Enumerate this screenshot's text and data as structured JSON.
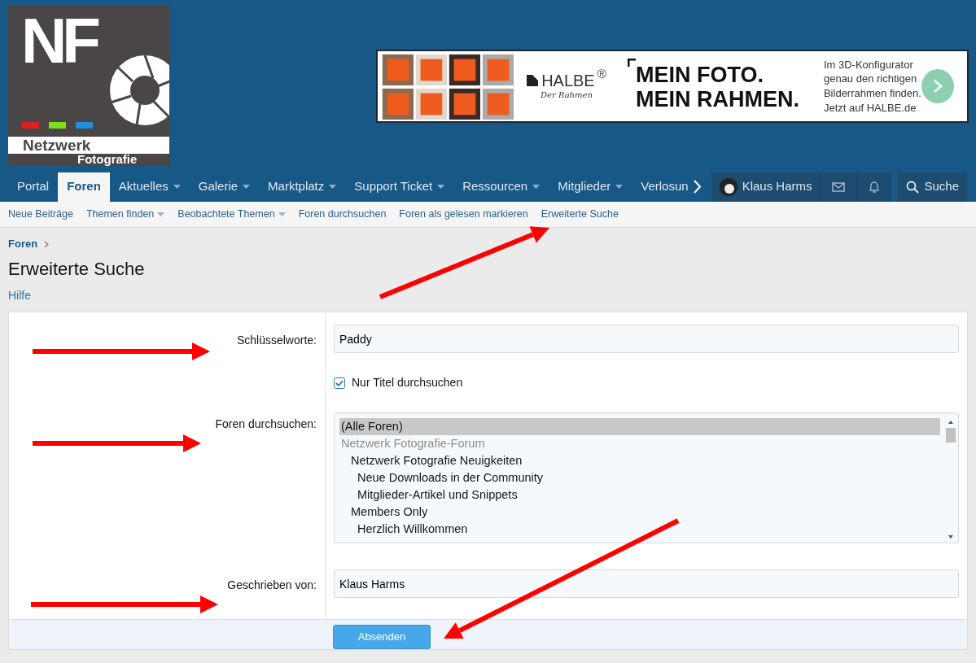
{
  "logo": {
    "initials": "NF",
    "line_1": "Netzwerk",
    "line_2": "Fotografie",
    "color_bars": [
      {
        "color": "#e02020"
      },
      {
        "color": "#7be01a"
      },
      {
        "color": "#1e8fd8"
      }
    ]
  },
  "ad_banner": {
    "brand": "HALBE$^{®}$",
    "brand_tagline": "Der Rahmen",
    "headline": [
      "MEIN FOTO.",
      "MEIN RAHMEN."
    ],
    "text": [
      "Im 3D-Konfigurator",
      "genau den richtigen",
      "Bilderrahmen finden.",
      "Jetzt auf HALBE.de"
    ]
  },
  "nav": {
    "tabs": [
      {
        "label": "Portal",
        "selected": false,
        "has_menu": false
      },
      {
        "label": "Foren",
        "selected": true,
        "has_menu": false
      },
      {
        "label": "Aktuelles",
        "selected": false,
        "has_menu": true
      },
      {
        "label": "Galerie",
        "selected": false,
        "has_menu": true
      },
      {
        "label": "Marktplatz",
        "selected": false,
        "has_menu": true
      },
      {
        "label": "Support Ticket",
        "selected": false,
        "has_menu": true
      },
      {
        "label": "Ressourcen",
        "selected": false,
        "has_menu": true
      },
      {
        "label": "Mitglieder",
        "selected": false,
        "has_menu": true
      },
      {
        "label": "Verlosun",
        "selected": false,
        "has_menu": false
      }
    ],
    "user": {
      "name": "Klaus Harms"
    },
    "search_button": {
      "label": "Suche"
    }
  },
  "subnav": [
    {
      "label": "Neue Beiträge",
      "has_menu": false
    },
    {
      "label": "Themen finden",
      "has_menu": true
    },
    {
      "label": "Beobachtete Themen",
      "has_menu": true
    },
    {
      "label": "Foren durchsuchen",
      "has_menu": false
    },
    {
      "label": "Foren als gelesen markieren",
      "has_menu": false
    },
    {
      "label": "Erweiterte Suche",
      "has_menu": false
    }
  ],
  "breadcrumb": [
    {
      "label": "Foren"
    }
  ],
  "title": "Erweiterte Suche",
  "help_link": "Hilfe",
  "form": {
    "keywords": {
      "label": "Schlüsselworte:",
      "value": "Paddy"
    },
    "title_only": {
      "label": "Nur Titel durchsuchen",
      "checked": true
    },
    "forums": {
      "label": "Foren durchsuchen:",
      "options": [
        {
          "label": "(Alle Foren)",
          "selected": true,
          "disabled": false
        },
        {
          "label": "Netzwerk Fotografie-Forum",
          "selected": false,
          "disabled": true,
          "children": [
            {
              "label": "Netzwerk Fotografie Neuigkeiten",
              "selected": false,
              "disabled": false,
              "children": [
                {
                  "label": "Neue Downloads in der Community",
                  "selected": false,
                  "disabled": false
                },
                {
                  "label": "Mitglieder-Artikel und Snippets",
                  "selected": false,
                  "disabled": false
                }
              ]
            },
            {
              "label": "Members Only",
              "selected": false,
              "disabled": false,
              "children": [
                {
                  "label": "Herzlich Willkommen",
                  "selected": false,
                  "disabled": false
                }
              ]
            }
          ]
        }
      ]
    },
    "author": {
      "label": "Geschrieben von:",
      "value": "Klaus Harms"
    },
    "submit": {
      "label": "Absenden"
    }
  }
}
